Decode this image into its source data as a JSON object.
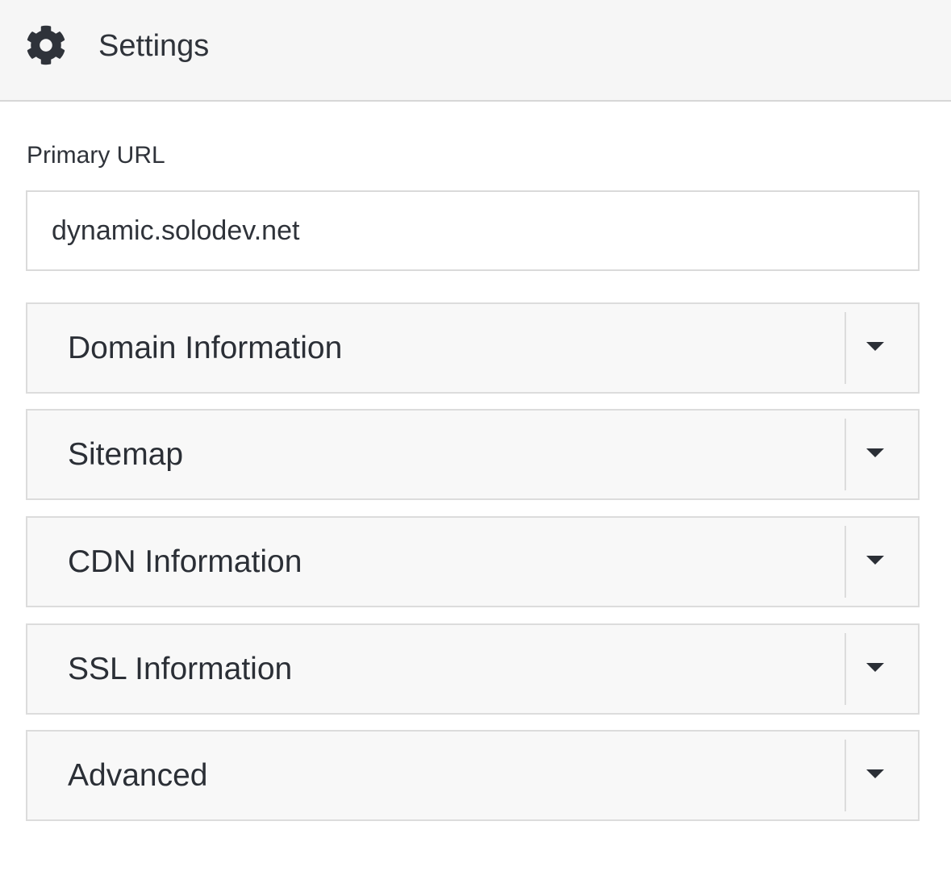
{
  "header": {
    "icon": "gear-icon",
    "title": "Settings"
  },
  "primary_url": {
    "label": "Primary URL",
    "value": "dynamic.solodev.net",
    "placeholder": ""
  },
  "panels": [
    {
      "label": "Domain Information",
      "icon": "caret-down-icon"
    },
    {
      "label": "Sitemap",
      "icon": "caret-down-icon"
    },
    {
      "label": "CDN Information",
      "icon": "caret-down-icon"
    },
    {
      "label": "SSL Information",
      "icon": "caret-down-icon"
    },
    {
      "label": "Advanced",
      "icon": "caret-down-icon"
    }
  ],
  "colors": {
    "header_bg": "#f6f6f6",
    "panel_bg": "#f8f8f8",
    "border": "#dcdcdc",
    "text": "#2b2f36"
  }
}
